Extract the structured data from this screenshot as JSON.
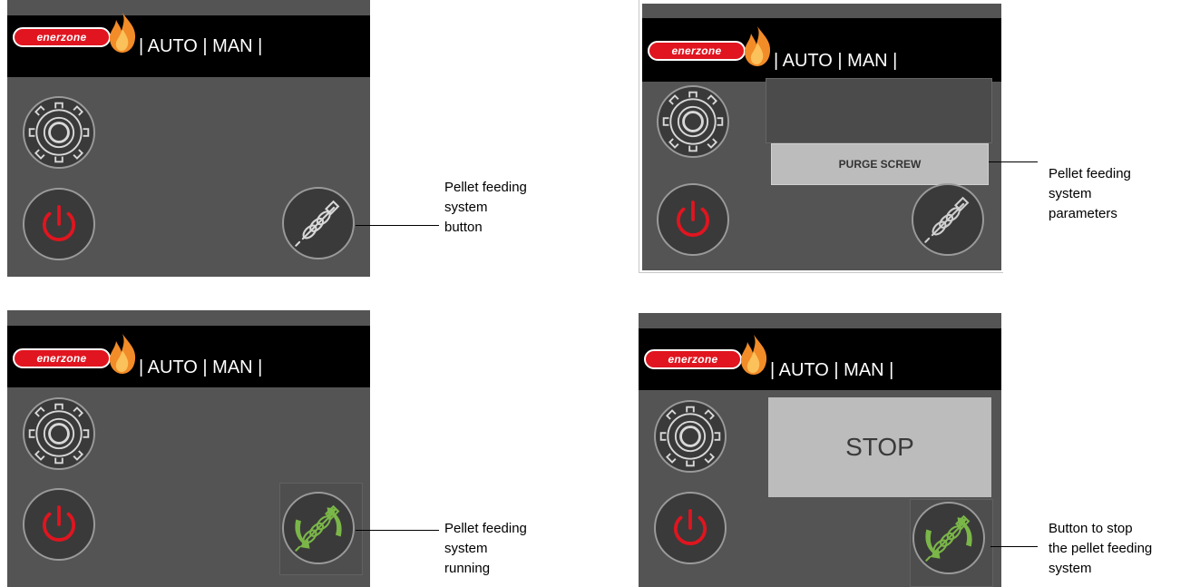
{
  "brand": {
    "logo_text": "enerzone"
  },
  "header": {
    "modes": "| AUTO | MAN |"
  },
  "icons": {
    "settings": "gear-icon",
    "power": "power-icon",
    "screw": "auger-screw-icon",
    "screw_running": "auger-screw-running-icon"
  },
  "colors": {
    "panel_bg": "#545454",
    "header_bg": "#000000",
    "power_red": "#e0151f",
    "running_green": "#7ab648",
    "logo_red": "#e0151f",
    "flame_orange": "#f28c28"
  },
  "panels": [
    {
      "id": "top-left",
      "callout": [
        "Pellet feeding",
        "system",
        "button"
      ]
    },
    {
      "id": "top-right",
      "purge_label": "PURGE SCREW",
      "callout": [
        "Pellet feeding",
        "system",
        "parameters"
      ]
    },
    {
      "id": "bottom-left",
      "callout": [
        "Pellet feeding",
        "system",
        "running"
      ]
    },
    {
      "id": "bottom-right",
      "stop_label": "STOP",
      "callout": [
        "Button to stop",
        "the pellet feeding",
        "system"
      ]
    }
  ]
}
